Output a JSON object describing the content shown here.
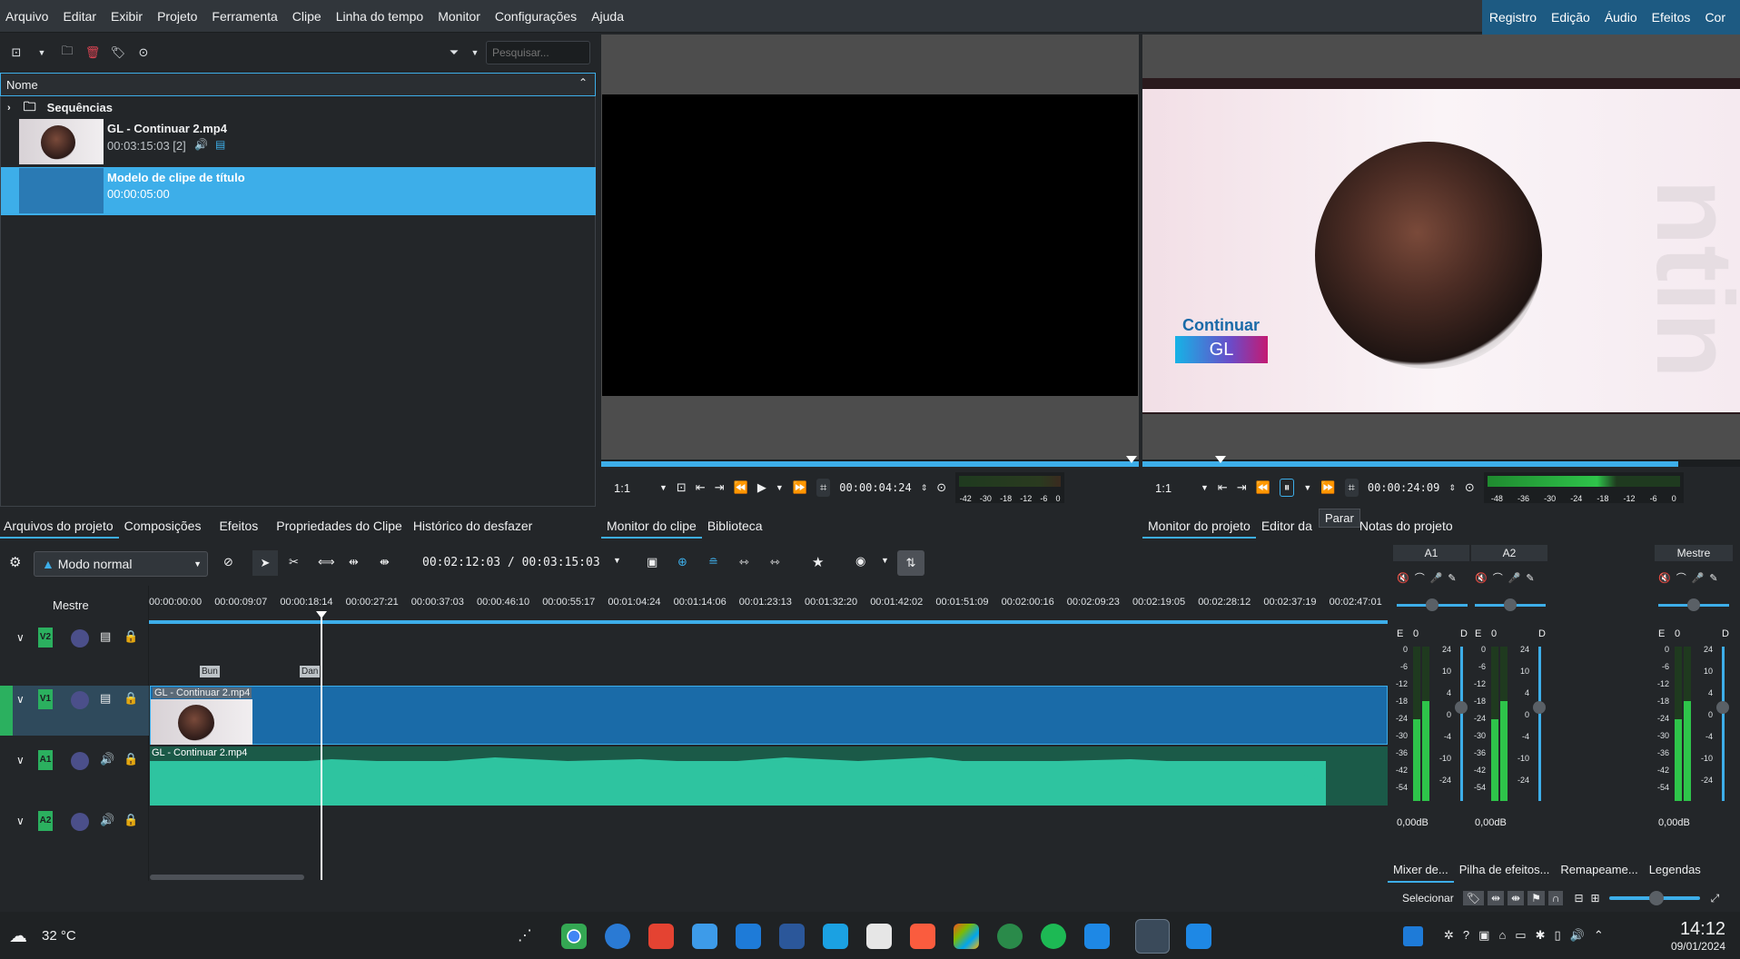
{
  "menu": [
    "Arquivo",
    "Editar",
    "Exibir",
    "Projeto",
    "Ferramenta",
    "Clipe",
    "Linha do tempo",
    "Monitor",
    "Configurações",
    "Ajuda"
  ],
  "layouts": [
    "Registro",
    "Edição",
    "Áudio",
    "Efeitos",
    "Cor"
  ],
  "bin": {
    "search_placeholder": "Pesquisar...",
    "column_name": "Nome",
    "folder": "Sequências",
    "clip": {
      "name": "GL - Continuar 2.mp4",
      "duration": "00:03:15:03 [2]"
    },
    "title_clip": {
      "name": "Modelo de clipe de título",
      "duration": "00:00:05:00"
    }
  },
  "bin_tabs": [
    "Arquivos do projeto",
    "Composições",
    "Efeitos",
    "Propriedades do Clipe",
    "Histórico do desfazer"
  ],
  "clip_monitor": {
    "zoom": "1:1",
    "timecode": "00:00:04:24",
    "meter": [
      "-42",
      "-30",
      "-18",
      "-12",
      "-6",
      "0"
    ]
  },
  "clip_monitor_tabs": [
    "Monitor do clipe",
    "Biblioteca"
  ],
  "project_monitor": {
    "zoom": "1:1",
    "timecode": "00:00:24:09",
    "meter": [
      "-48",
      "-36",
      "-30",
      "-24",
      "-18",
      "-12",
      "-6",
      "0"
    ],
    "tooltip": "Parar",
    "preview_title": "Continuar",
    "preview_subtitle": "GL",
    "watermark": "ntin"
  },
  "project_monitor_tabs": [
    "Monitor do projeto",
    "Editor da",
    "Notas do projeto"
  ],
  "timeline_toolbar": {
    "mode": "Modo normal",
    "timecode": "00:02:12:03 / 00:03:15:03"
  },
  "timeline": {
    "master_label": "Mestre",
    "ruler": [
      "00:00:00:00",
      "00:00:09:07",
      "00:00:18:14",
      "00:00:27:21",
      "00:00:37:03",
      "00:00:46:10",
      "00:00:55:17",
      "00:01:04:24",
      "00:01:14:06",
      "00:01:23:13",
      "00:01:32:20",
      "00:01:42:02",
      "00:01:51:09",
      "00:02:00:16",
      "00:02:09:23",
      "00:02:19:05",
      "00:02:28:12",
      "00:02:37:19",
      "00:02:47:01"
    ],
    "tracks": [
      "V2",
      "V1",
      "A1",
      "A2"
    ],
    "markers": [
      "Bun",
      "Dan"
    ],
    "video_clip": "GL - Continuar 2.mp4",
    "audio_clip": "GL - Continuar 2.mp4"
  },
  "mixer": {
    "strips": [
      "A1",
      "A2",
      "Mestre"
    ],
    "balance_label_l": "E",
    "balance_label_r": "D",
    "balance_value": "0",
    "db_value": "0,00dB",
    "left_scale": [
      "0",
      "-6",
      "-12",
      "-18",
      "-24",
      "-30",
      "-36",
      "-42",
      "-54"
    ],
    "right_scale": [
      "24",
      "10",
      "4",
      "0",
      "-4",
      "-10",
      "-24"
    ]
  },
  "mixer_tabs": [
    "Mixer de...",
    "Pilha de efeitos...",
    "Remapeame...",
    "Legendas"
  ],
  "select_label": "Selecionar",
  "taskbar": {
    "weather": "32 °C",
    "time": "14:12",
    "date": "09/01/2024"
  },
  "colors": {
    "accent": "#3daee9",
    "selection": "#3daee9",
    "audio_wave": "#2ec4a0",
    "video_clip": "#1a6ba8",
    "track_tag": "#2bb05f"
  }
}
